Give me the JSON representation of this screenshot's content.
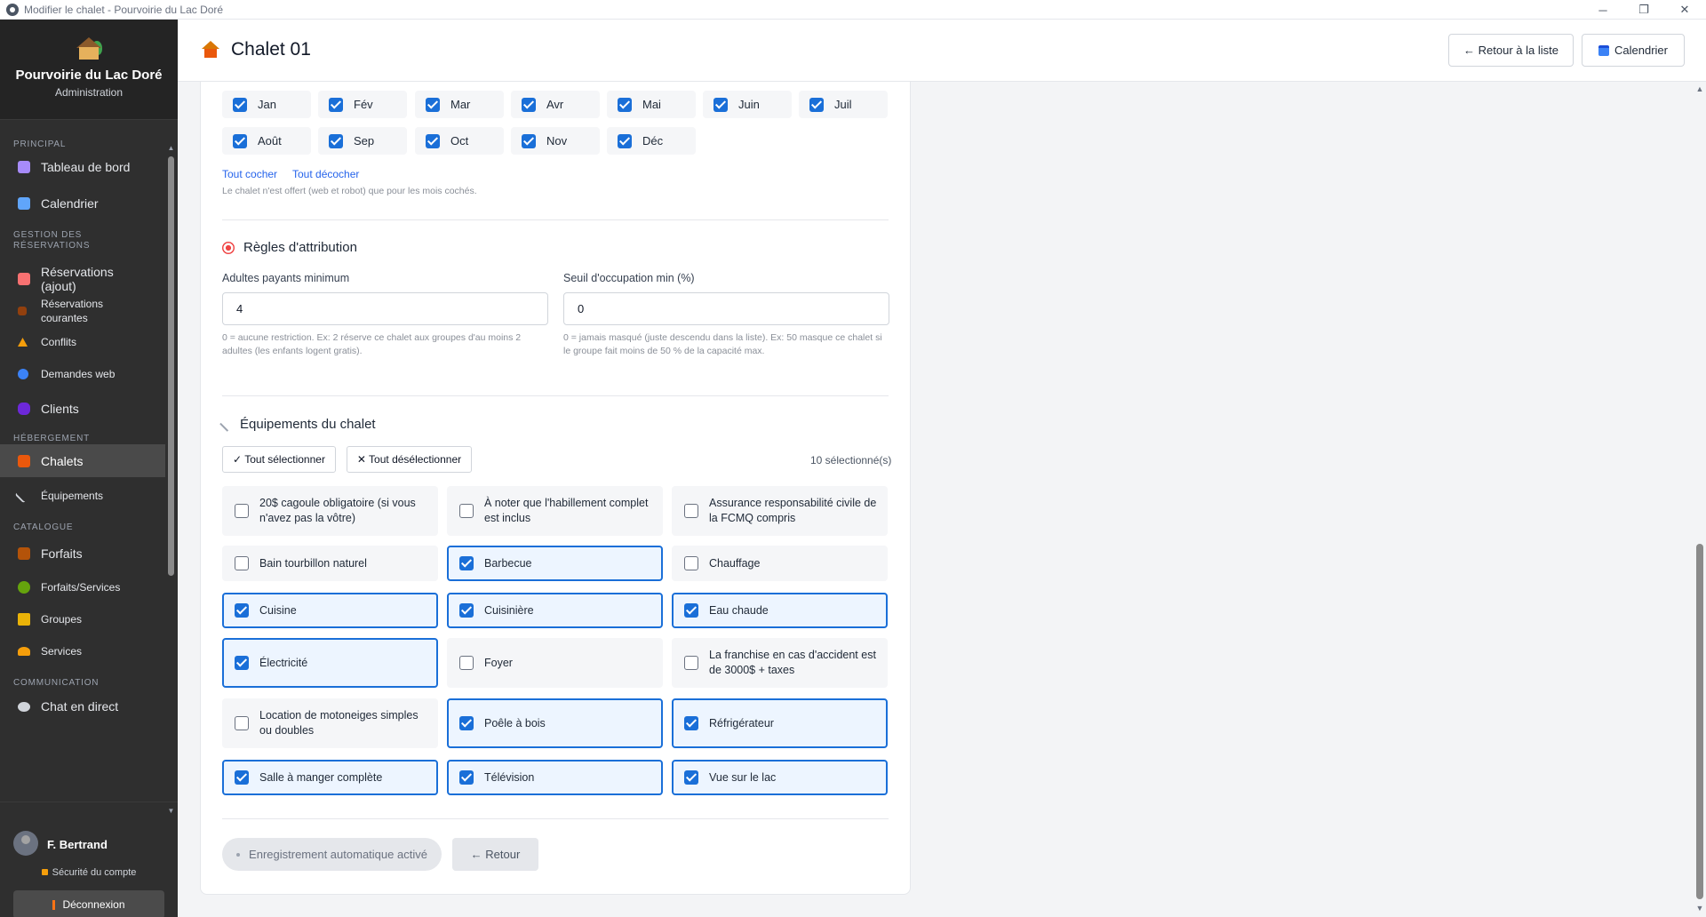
{
  "window": {
    "title": "Modifier le chalet - Pourvoirie du Lac Doré"
  },
  "brand": {
    "name": "Pourvoirie du Lac Doré",
    "subtitle": "Administration"
  },
  "nav": {
    "principal": "PRINCIPAL",
    "tableau": "Tableau de bord",
    "calendrier": "Calendrier",
    "gestion_line1": "GESTION DES",
    "gestion_line2": "RÉSERVATIONS",
    "res_ajout": "Réservations (ajout)",
    "res_courantes_1": "Réservations",
    "res_courantes_2": "courantes",
    "conflits": "Conflits",
    "demandes": "Demandes web",
    "clients": "Clients",
    "hebergement": "HÉBERGEMENT",
    "chalets": "Chalets",
    "equipements": "Équipements",
    "catalogue": "CATALOGUE",
    "forfaits": "Forfaits",
    "forfaits_services": "Forfaits/Services",
    "groupes": "Groupes",
    "services": "Services",
    "communication": "COMMUNICATION",
    "chat": "Chat en direct"
  },
  "user": {
    "name": "F. Bertrand",
    "security": "Sécurité du compte",
    "logout": "Déconnexion"
  },
  "header": {
    "title": "Chalet 01",
    "back_list": "← Retour à la liste",
    "calendar": "Calendrier"
  },
  "months": {
    "m1": "Jan",
    "m2": "Fév",
    "m3": "Mar",
    "m4": "Avr",
    "m5": "Mai",
    "m6": "Juin",
    "m7": "Juil",
    "m8": "Août",
    "m9": "Sep",
    "m10": "Oct",
    "m11": "Nov",
    "m12": "Déc",
    "check_all": "Tout cocher",
    "uncheck_all": "Tout décocher",
    "help": "Le chalet n'est offert (web et robot) que pour les mois cochés."
  },
  "rules": {
    "title": "Règles d'attribution",
    "adults_label": "Adultes payants minimum",
    "adults_value": "4",
    "adults_help_1": "0 = aucune restriction. Ex: 2 réserve ce chalet aux groupes d'au moins 2",
    "adults_help_2": "adultes (les enfants logent gratis).",
    "occ_label": "Seuil d'occupation min (%)",
    "occ_value": "0",
    "occ_help_1": "0 = jamais masqué (juste descendu dans la liste). Ex: 50 masque ce chalet si",
    "occ_help_2": "le groupe fait moins de 50 % de la capacité max."
  },
  "equip": {
    "title": "Équipements du chalet",
    "select_all": "✓ Tout sélectionner",
    "deselect_all": "✕ Tout désélectionner",
    "count": "10 sélectionné(s)",
    "e1": "20$ cagoule obligatoire (si vous n'avez pas la vôtre)",
    "e2": "À noter que l'habillement complet est inclus",
    "e3": "Assurance responsabilité civile de la FCMQ compris",
    "e4": "Bain tourbillon naturel",
    "e5": "Barbecue",
    "e6": "Chauffage",
    "e7": "Cuisine",
    "e8": "Cuisinière",
    "e9": "Eau chaude",
    "e10": "Électricité",
    "e11": "Foyer",
    "e12": "La franchise en cas d'accident est de 3000$ + taxes",
    "e13": "Location de motoneiges simples ou doubles",
    "e14": "Poêle à bois",
    "e15": "Réfrigérateur",
    "e16": "Salle à manger complète",
    "e17": "Télévision",
    "e18": "Vue sur le lac"
  },
  "footer": {
    "autosave": "Enregistrement automatique activé",
    "back": "← Retour"
  }
}
